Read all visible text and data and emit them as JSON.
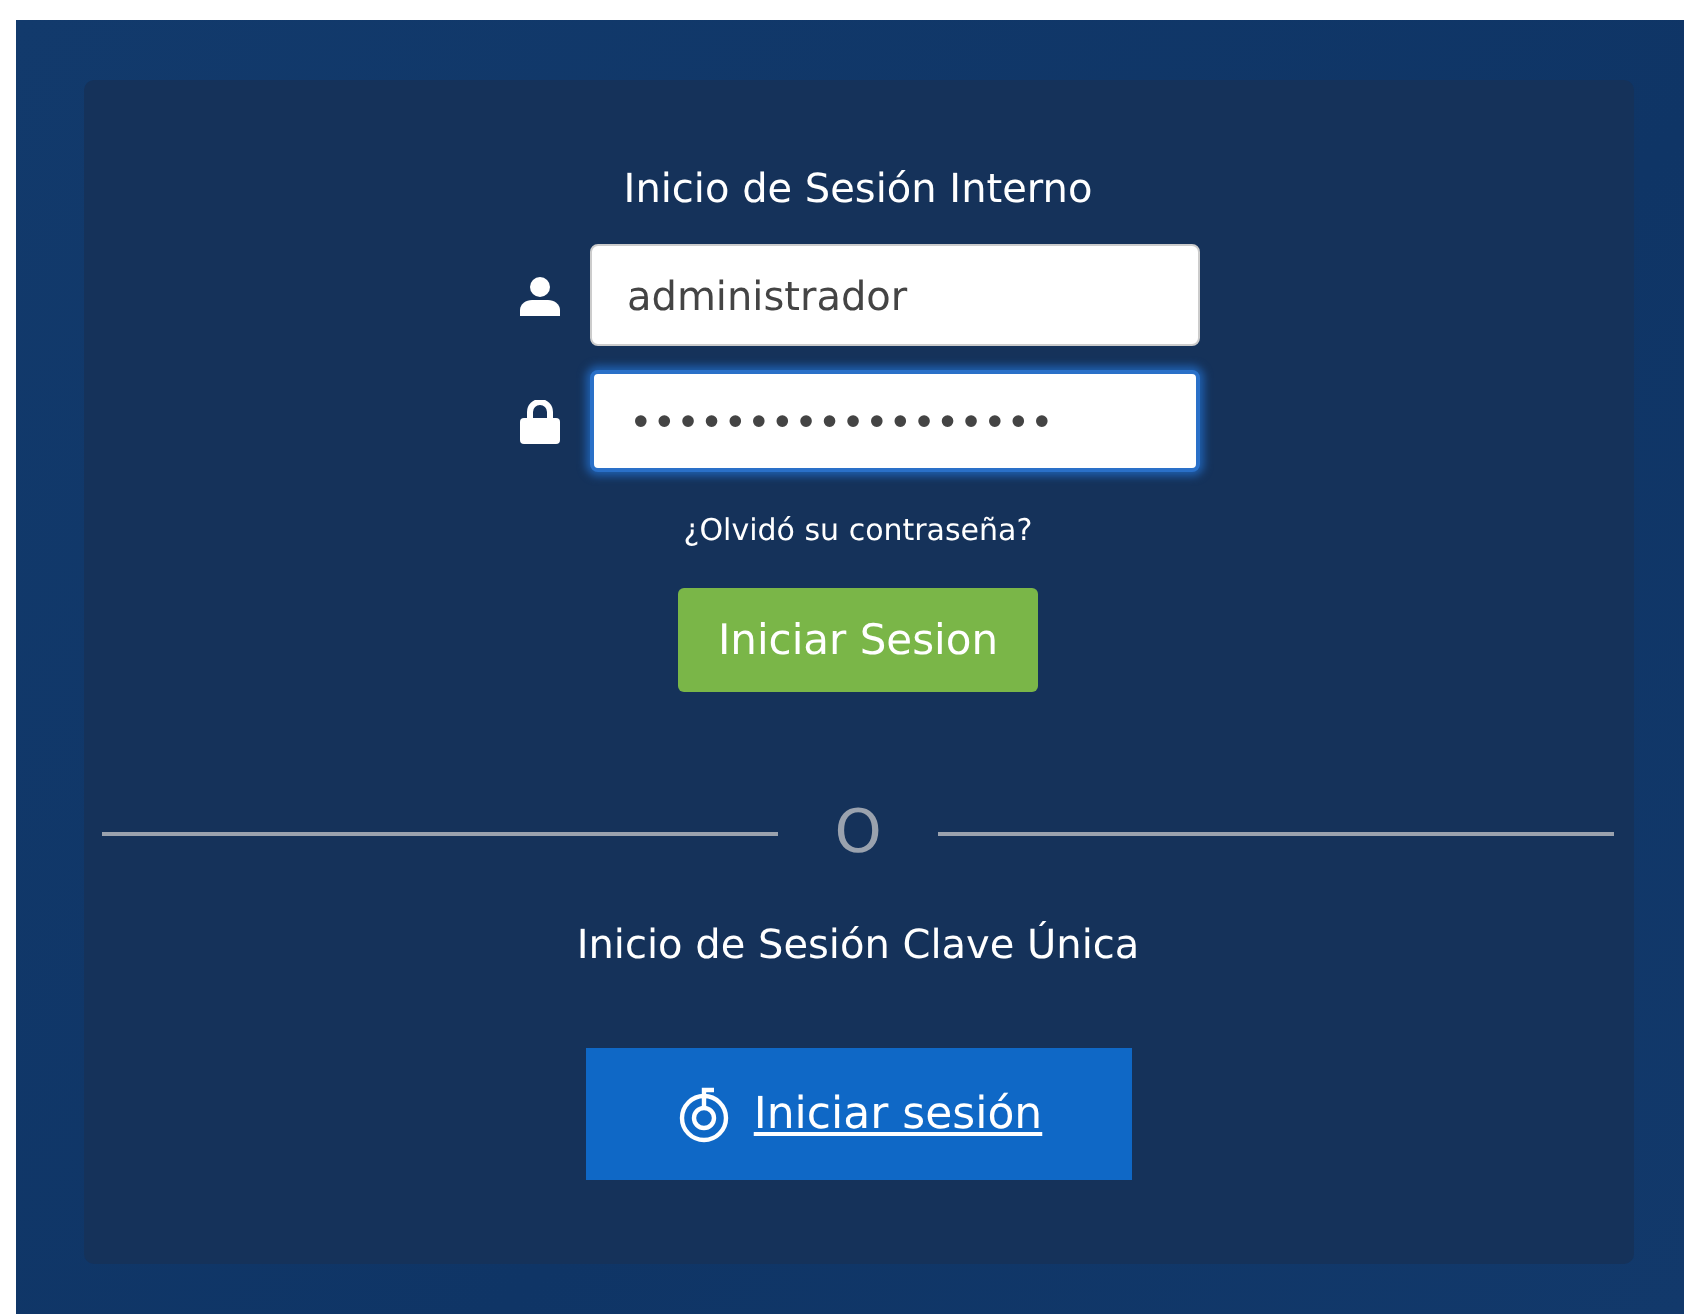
{
  "internal_login": {
    "title": "Inicio de Sesión Interno",
    "fields": [
      {
        "kind": "user",
        "value": "administrador",
        "focused": false
      },
      {
        "kind": "password",
        "value": "••••••••••••••••••",
        "focused": true
      }
    ],
    "forgot_link": "¿Olvidó su contraseña?",
    "submit_button": "Iniciar Sesion"
  },
  "divider": {
    "label": "O"
  },
  "clave_unica": {
    "title": "Inicio de Sesión Clave Única",
    "button": "Iniciar sesión"
  }
}
